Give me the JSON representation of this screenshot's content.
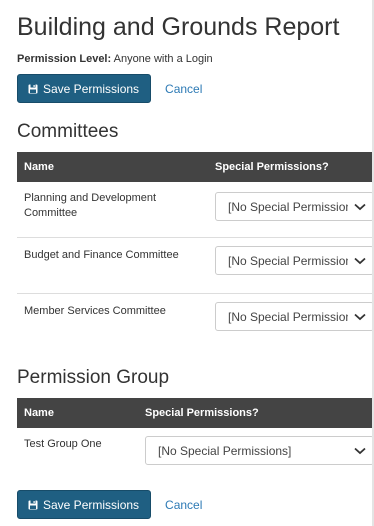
{
  "page": {
    "title": "Building and Grounds Report",
    "permission_level_label": "Permission Level:",
    "permission_level_value": "Anyone with a Login"
  },
  "actions": {
    "save_label": "Save Permissions",
    "cancel_label": "Cancel"
  },
  "committees": {
    "heading": "Committees",
    "columns": [
      "Name",
      "Special Permissions?"
    ],
    "rows": [
      {
        "name_line1": "Planning and Development",
        "name_line2": "Committee",
        "permission": "[No Special Permissions]"
      },
      {
        "name_line1": "Budget and Finance Committee",
        "name_line2": "",
        "permission": "[No Special Permissions]"
      },
      {
        "name_line1": "Member Services Committee",
        "name_line2": "",
        "permission": "[No Special Permissions]"
      }
    ]
  },
  "permission_group": {
    "heading": "Permission Group",
    "columns": [
      "Name",
      "Special Permissions?"
    ],
    "rows": [
      {
        "name": "Test Group One",
        "permission": "[No Special Permissions]"
      }
    ]
  },
  "icons": {
    "save": "floppy-disk-icon",
    "dropdown": "chevron-down-icon"
  },
  "colors": {
    "primary_button": "#1f5f82",
    "table_header": "#444444",
    "link": "#2d7ab5"
  }
}
